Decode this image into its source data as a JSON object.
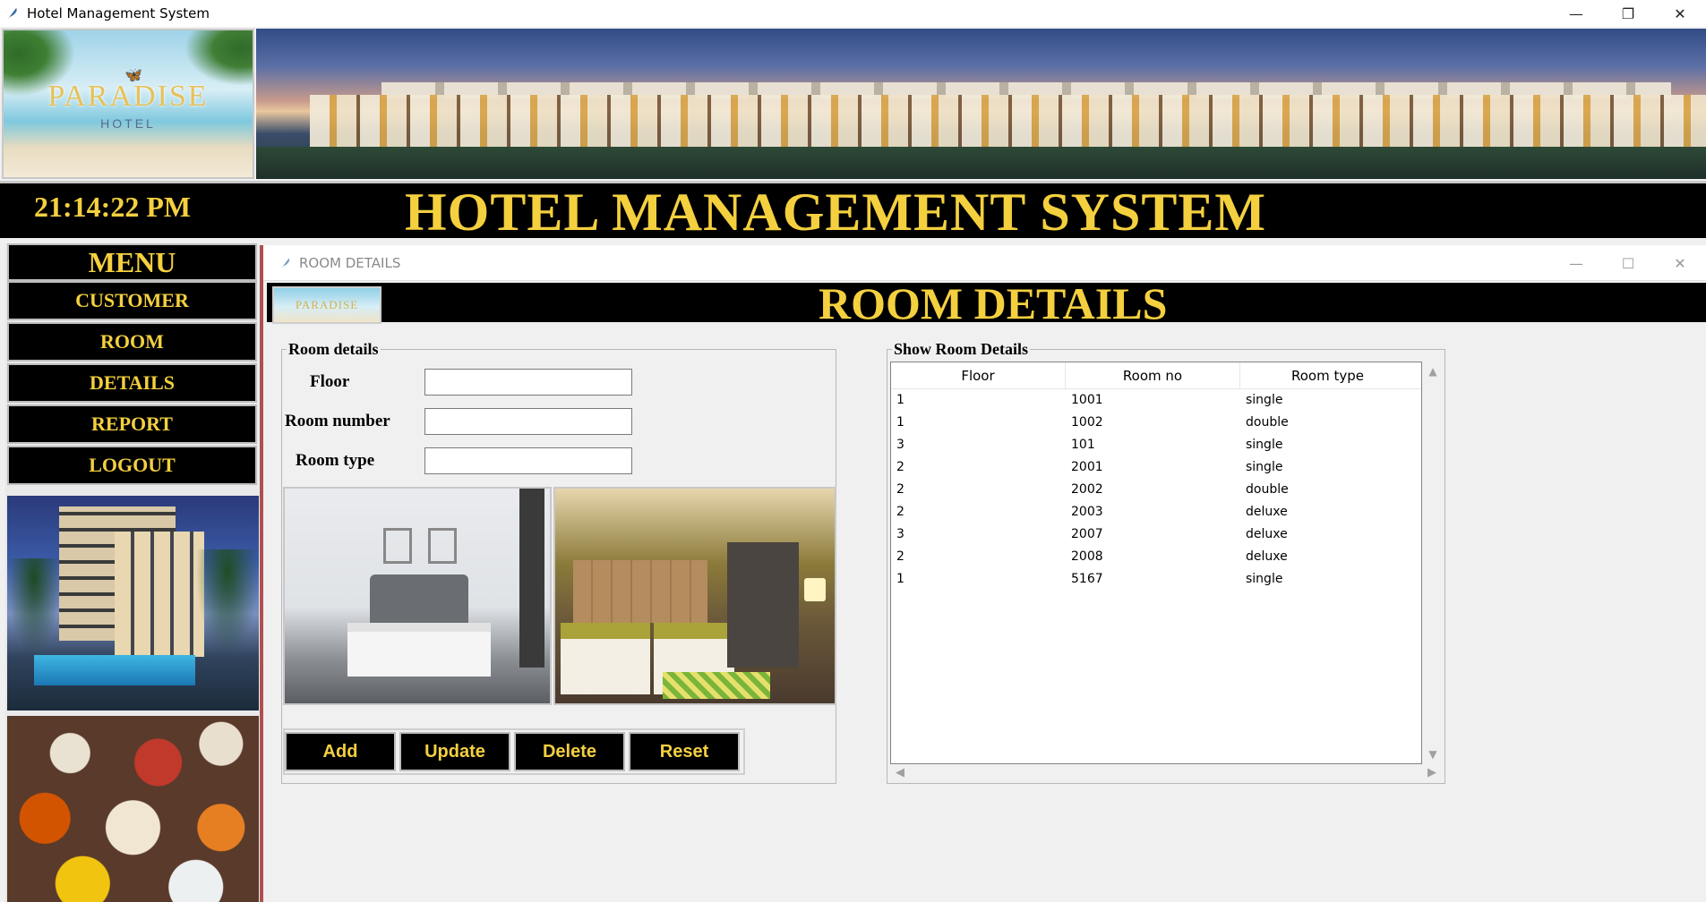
{
  "window": {
    "title": "Hotel Management System",
    "controls": {
      "minimize": "—",
      "restore": "❐",
      "close": "✕"
    }
  },
  "logo": {
    "brand": "PARADISE",
    "sub": "HOTEL"
  },
  "header": {
    "clock": "21:14:22 PM",
    "title": "HOTEL MANAGEMENT SYSTEM"
  },
  "menu": {
    "title": "MENU",
    "items": [
      "CUSTOMER",
      "ROOM",
      "DETAILS",
      "REPORT",
      "LOGOUT"
    ]
  },
  "child_window": {
    "title": "ROOM DETAILS",
    "controls": {
      "minimize": "—",
      "maximize": "☐",
      "close": "✕"
    },
    "heading": "ROOM DETAILS",
    "logo_text": "PARADISE"
  },
  "form": {
    "legend": "Room details",
    "floor_label": "Floor",
    "room_number_label": "Room number",
    "room_type_label": "Room type",
    "floor_value": "",
    "room_number_value": "",
    "room_type_value": ""
  },
  "actions": {
    "add": "Add",
    "update": "Update",
    "delete": "Delete",
    "reset": "Reset"
  },
  "table": {
    "legend": "Show Room Details",
    "columns": [
      "Floor",
      "Room no",
      "Room type"
    ],
    "rows": [
      [
        "1",
        "1001",
        "single"
      ],
      [
        "1",
        "1002",
        "double"
      ],
      [
        "3",
        "101",
        "single"
      ],
      [
        "2",
        "2001",
        "single"
      ],
      [
        "2",
        "2002",
        "double"
      ],
      [
        "2",
        "2003",
        "deluxe"
      ],
      [
        "3",
        "2007",
        "deluxe"
      ],
      [
        "2",
        "2008",
        "deluxe"
      ],
      [
        "1",
        "5167",
        "single"
      ]
    ]
  },
  "colors": {
    "accent": "#f4d03f",
    "bar": "#000000"
  }
}
